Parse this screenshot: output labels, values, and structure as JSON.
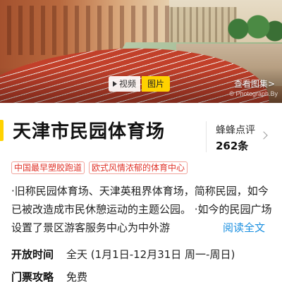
{
  "hero": {
    "video_label": "视频",
    "photo_label": "图片",
    "more_photos": "查看图集",
    "watermark": "© Photograph.By"
  },
  "title": "天津市民园体育场",
  "review": {
    "source": "蜂蜂点评",
    "count": "262条"
  },
  "tags": [
    "中国最早塑胶跑道",
    "欧式风情浓郁的体育中心"
  ],
  "description": {
    "text": "·旧称民园体育场、天津英租界体育场，简称民园，如今已被改造成市民休憩运动的主题公园。 ·如今的民园广场设置了景区游客服务中心为中外游",
    "read_more": "阅读全文"
  },
  "info": [
    {
      "key": "开放时间",
      "value": "全天 (1月1日-12月31日 周一-周日)"
    },
    {
      "key": "门票攻略",
      "value": "免费"
    }
  ],
  "colors": {
    "accent": "#ffd200",
    "tag_red": "#e0342a",
    "link_blue": "#1a8fe0"
  }
}
